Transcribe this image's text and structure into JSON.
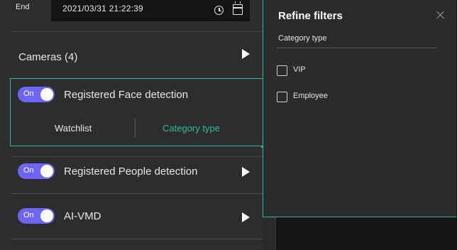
{
  "time_filter": {
    "end_label": "End",
    "end_value": "2021/03/31 21:22:39"
  },
  "rows": {
    "cameras_label": "Cameras (4)",
    "face_detection": {
      "toggle_text": "On",
      "label": "Registered Face detection",
      "tabs": [
        "Watchlist",
        "Category type"
      ],
      "active_tab_color": "#2fb9a0"
    },
    "people_detection": {
      "toggle_text": "On",
      "label": "Registered People detection"
    },
    "ai_vmd": {
      "toggle_text": "On",
      "label": "AI-VMD"
    }
  },
  "refine_filters": {
    "title": "Refine filters",
    "section_label": "Category type",
    "options": [
      {
        "label": "VIP",
        "checked": false
      },
      {
        "label": "Employee",
        "checked": false
      }
    ]
  },
  "colors": {
    "accent_teal": "#2fb9a0",
    "toggle_purple": "#6e64f5"
  },
  "icons": [
    "clock-icon",
    "calendar-icon",
    "play-arrow-icon",
    "close-icon"
  ]
}
